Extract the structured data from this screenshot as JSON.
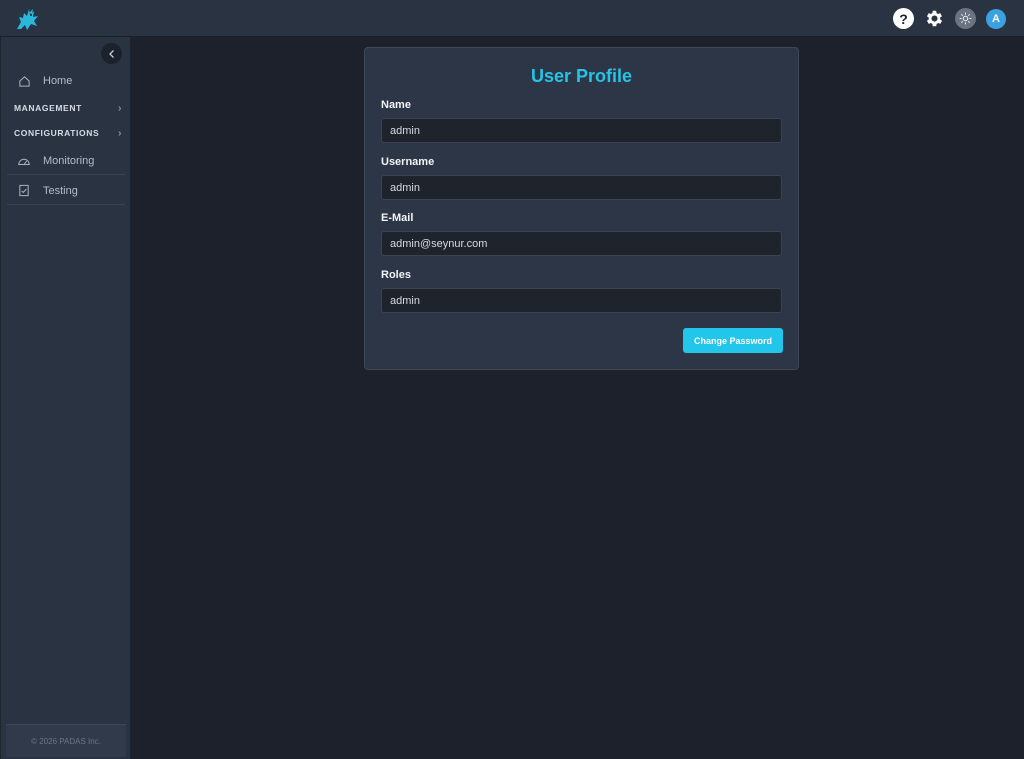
{
  "header": {
    "help_glyph": "?",
    "avatar_initial": "A",
    "icons": [
      "dragon-logo-icon",
      "help-icon",
      "gear-icon",
      "sun-icon",
      "avatar"
    ]
  },
  "sidebar": {
    "home_label": "Home",
    "management_label": "MANAGEMENT",
    "configurations_label": "CONFIGURATIONS",
    "monitoring_label": "Monitoring",
    "testing_label": "Testing",
    "footer": "© 2026 PADAS Inc."
  },
  "profile": {
    "title": "User Profile",
    "name_label": "Name",
    "name_value": "admin",
    "username_label": "Username",
    "username_value": "admin",
    "email_label": "E-Mail",
    "email_value": "admin@seynur.com",
    "roles_label": "Roles",
    "roles_value": "admin",
    "change_password_label": "Change Password"
  },
  "colors": {
    "accent": "#22c6ea",
    "background": "#1c212b",
    "panel": "#2a3342"
  }
}
